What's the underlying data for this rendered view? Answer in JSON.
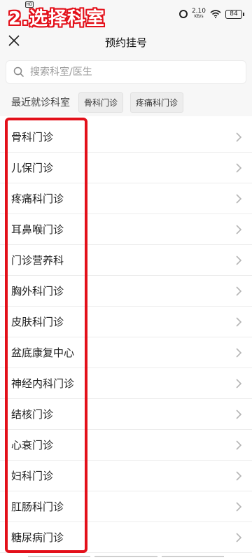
{
  "overlay": {
    "step_title": "2.选择科室"
  },
  "status": {
    "speed_value": "2.10",
    "speed_unit": "KB/s",
    "battery": "84"
  },
  "navbar": {
    "title": "预约挂号"
  },
  "search": {
    "placeholder": "搜索科室/医生"
  },
  "recent": {
    "label": "最近就诊科室",
    "chips": [
      "骨科门诊",
      "疼痛科门诊"
    ]
  },
  "departments": [
    "骨科门诊",
    "儿保门诊",
    "疼痛科门诊",
    "耳鼻喉门诊",
    "门诊营养科",
    "胸外科门诊",
    "皮肤科门诊",
    "盆底康复中心",
    "神经内科门诊",
    "结核门诊",
    "心衰门诊",
    "妇科门诊",
    "肛肠科门诊",
    "糖尿病门诊"
  ],
  "colors": {
    "highlight": "#e3101a",
    "background": "#f7f7f7"
  }
}
